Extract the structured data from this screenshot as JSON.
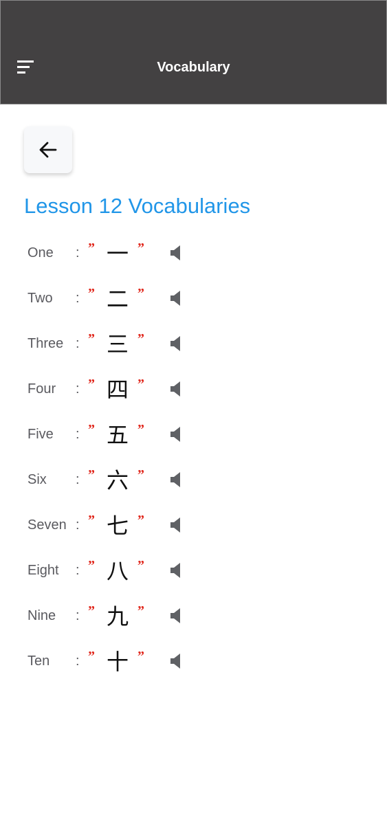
{
  "header": {
    "title": "Vocabulary",
    "background": "#434142",
    "menu_icon": "hamburger-menu-icon"
  },
  "back_button": {
    "icon": "arrow-left-icon"
  },
  "lesson": {
    "title": "Lesson 12 Vocabularies",
    "title_color": "#2196e8"
  },
  "vocabulary": [
    {
      "word": "One",
      "hanzi": "一"
    },
    {
      "word": "Two",
      "hanzi": "二"
    },
    {
      "word": "Three",
      "hanzi": "三"
    },
    {
      "word": "Four",
      "hanzi": "四"
    },
    {
      "word": "Five",
      "hanzi": "五"
    },
    {
      "word": "Six",
      "hanzi": "六"
    },
    {
      "word": "Seven",
      "hanzi": "七"
    },
    {
      "word": "Eight",
      "hanzi": "八"
    },
    {
      "word": "Nine",
      "hanzi": "九"
    },
    {
      "word": "Ten",
      "hanzi": "十"
    }
  ],
  "separators": {
    "colon": ":",
    "quote_open": "”",
    "quote_close": "”",
    "quote_color": "#e0261b"
  },
  "speaker_icon": "speaker-icon"
}
